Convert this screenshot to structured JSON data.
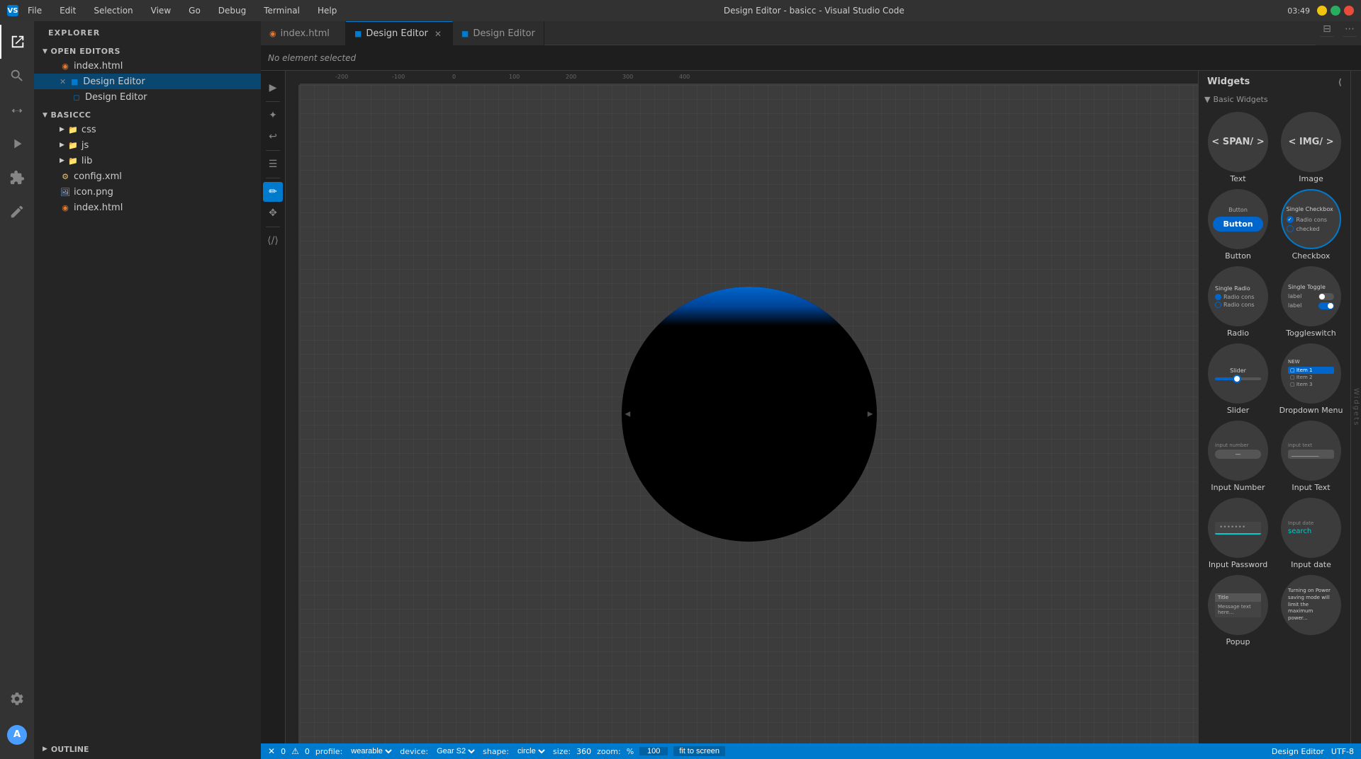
{
  "titleBar": {
    "title": "Design Editor - basicc - Visual Studio Code",
    "menuItems": [
      "File",
      "Edit",
      "Selection",
      "View",
      "Go",
      "Debug",
      "Terminal",
      "Help"
    ],
    "time": "03:49",
    "windowControls": [
      "minimize",
      "maximize",
      "close"
    ]
  },
  "activityBar": {
    "items": [
      {
        "name": "explorer",
        "icon": "📁"
      },
      {
        "name": "search",
        "icon": "🔍"
      },
      {
        "name": "source-control",
        "icon": "⑂"
      },
      {
        "name": "run",
        "icon": "▷"
      },
      {
        "name": "extensions",
        "icon": "⊞"
      },
      {
        "name": "design",
        "icon": "✏️"
      }
    ]
  },
  "sidebar": {
    "title": "EXPLORER",
    "openEditors": {
      "label": "OPEN EDITORS",
      "items": [
        {
          "name": "index.html",
          "type": "html",
          "indent": 2
        },
        {
          "name": "Design Editor",
          "type": "active",
          "indent": 2,
          "modified": true
        },
        {
          "name": "Design Editor",
          "type": "child",
          "indent": 3
        }
      ]
    },
    "project": {
      "label": "BASICCC",
      "items": [
        {
          "name": "css",
          "type": "folder",
          "indent": 2
        },
        {
          "name": "js",
          "type": "folder",
          "indent": 2
        },
        {
          "name": "lib",
          "type": "folder",
          "indent": 2
        },
        {
          "name": "config.xml",
          "type": "xml",
          "indent": 2
        },
        {
          "name": "icon.png",
          "type": "png",
          "indent": 2
        },
        {
          "name": "index.html",
          "type": "html",
          "indent": 2
        }
      ]
    },
    "outline": {
      "label": "OUTLINE"
    }
  },
  "tabs": [
    {
      "label": "index.html",
      "type": "html",
      "active": false
    },
    {
      "label": "Design Editor",
      "type": "design",
      "active": true,
      "closeable": true
    },
    {
      "label": "Design Editor",
      "type": "design",
      "active": false
    }
  ],
  "canvas": {
    "noElementSelected": "No element selected",
    "device": "Gear S2",
    "profile": "wearable",
    "shape": "circle",
    "size": "360",
    "zoom": "100",
    "zoomPercent": "%",
    "fitButton": "fit to screen"
  },
  "widgets": {
    "title": "Widgets",
    "section": "Basic Widgets",
    "items": [
      {
        "id": "text",
        "label": "Text",
        "preview": "span",
        "content": "< SPAN/ >"
      },
      {
        "id": "image",
        "label": "Image",
        "preview": "img",
        "content": "< IMG/ >"
      },
      {
        "id": "button",
        "label": "Button",
        "preview": "button"
      },
      {
        "id": "checkbox",
        "label": "Checkbox",
        "preview": "checkbox",
        "selected": true
      },
      {
        "id": "radio",
        "label": "Radio",
        "preview": "radio"
      },
      {
        "id": "toggleswitch",
        "label": "Toggleswitch",
        "preview": "toggle"
      },
      {
        "id": "slider",
        "label": "Slider",
        "preview": "slider"
      },
      {
        "id": "dropdown",
        "label": "Dropdown Menu",
        "preview": "dropdown"
      },
      {
        "id": "inputnumber",
        "label": "Input Number",
        "preview": "inputnumber",
        "labelText": "input number"
      },
      {
        "id": "inputtext",
        "label": "Input Text",
        "preview": "inputtext",
        "labelText": "input text"
      },
      {
        "id": "inputpassword",
        "label": "Input Password",
        "preview": "inputpassword"
      },
      {
        "id": "inputdate",
        "label": "Input date",
        "preview": "inputdate"
      },
      {
        "id": "popup",
        "label": "Popup",
        "preview": "popup"
      },
      {
        "id": "power",
        "label": "",
        "preview": "power",
        "text": "Turning on Power saving mode will limit the maximum power..."
      }
    ]
  },
  "statusBar": {
    "errors": "0",
    "warnings": "0",
    "profile": "wearable",
    "device": "Gear S2",
    "shape": "circle",
    "zoom": "100",
    "fitButton": "fit to screen",
    "rightLabel": "Design Editor",
    "rightLabel2": "UTF-8"
  }
}
